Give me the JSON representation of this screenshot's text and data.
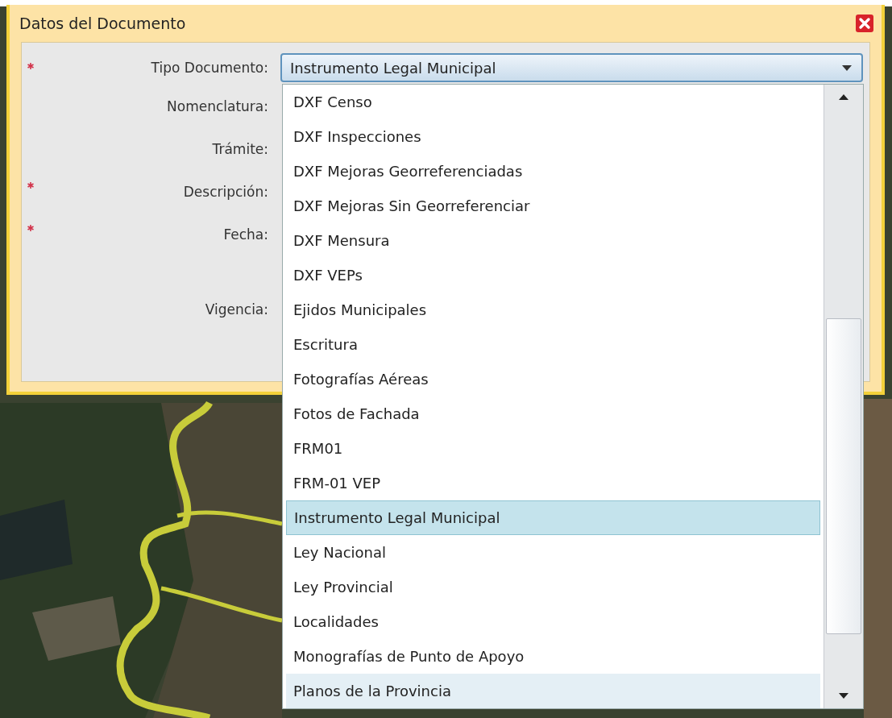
{
  "dialog": {
    "title": "Datos del Documento"
  },
  "fields": [
    {
      "label": "Tipo Documento:",
      "required": true
    },
    {
      "label": "Nomenclatura:",
      "required": false
    },
    {
      "label": "Trámite:",
      "required": false
    },
    {
      "label": "Descripción:",
      "required": true
    },
    {
      "label": "Fecha:",
      "required": true
    },
    {
      "label": "Vigencia:",
      "required": false
    }
  ],
  "select": {
    "value": "Instrumento Legal Municipal",
    "expanded": true
  },
  "options": [
    {
      "label": "DXF Censo",
      "selected": false,
      "hovered": false
    },
    {
      "label": "DXF Inspecciones",
      "selected": false,
      "hovered": false
    },
    {
      "label": "DXF Mejoras Georreferenciadas",
      "selected": false,
      "hovered": false
    },
    {
      "label": "DXF Mejoras Sin Georreferenciar",
      "selected": false,
      "hovered": false
    },
    {
      "label": "DXF Mensura",
      "selected": false,
      "hovered": false
    },
    {
      "label": "DXF VEPs",
      "selected": false,
      "hovered": false
    },
    {
      "label": "Ejidos Municipales",
      "selected": false,
      "hovered": false
    },
    {
      "label": "Escritura",
      "selected": false,
      "hovered": false
    },
    {
      "label": "Fotografías Aéreas",
      "selected": false,
      "hovered": false
    },
    {
      "label": "Fotos de Fachada",
      "selected": false,
      "hovered": false
    },
    {
      "label": "FRM01",
      "selected": false,
      "hovered": false
    },
    {
      "label": "FRM-01 VEP",
      "selected": false,
      "hovered": false
    },
    {
      "label": "Instrumento Legal Municipal",
      "selected": true,
      "hovered": false
    },
    {
      "label": "Ley Nacional",
      "selected": false,
      "hovered": false
    },
    {
      "label": "Ley Provincial",
      "selected": false,
      "hovered": false
    },
    {
      "label": "Localidades",
      "selected": false,
      "hovered": false
    },
    {
      "label": "Monografías de Punto de Apoyo",
      "selected": false,
      "hovered": false
    },
    {
      "label": "Planos de la Provincia",
      "selected": false,
      "hovered": true
    }
  ]
}
